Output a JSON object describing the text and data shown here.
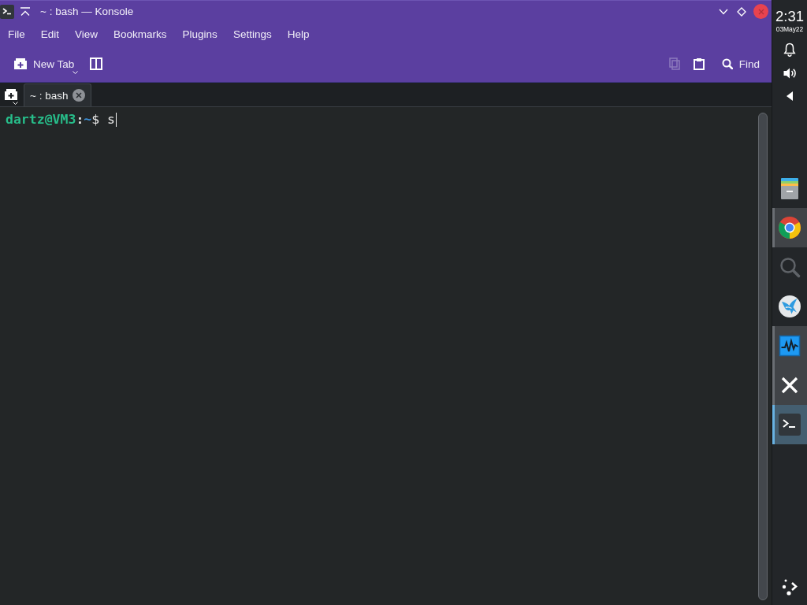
{
  "window": {
    "title": "~ : bash — Konsole"
  },
  "menu_bar": [
    "File",
    "Edit",
    "View",
    "Bookmarks",
    "Plugins",
    "Settings",
    "Help"
  ],
  "toolbar": {
    "left": [
      {
        "kind": "new-tab",
        "label": "New Tab",
        "disabled": false
      },
      {
        "kind": "split-view",
        "disabled": false
      }
    ],
    "right": [
      {
        "kind": "copy",
        "disabled": true
      },
      {
        "kind": "paste",
        "disabled": false
      },
      {
        "kind": "find",
        "label": "Find",
        "disabled": false
      }
    ]
  },
  "tabs": [
    {
      "label": "~ : bash",
      "selected": true
    }
  ],
  "terminal": {
    "lines": [
      {
        "user_host": "dartz@VM3",
        "separator": ":",
        "path": "~",
        "symbol": "$",
        "input": "s"
      }
    ]
  },
  "panel": {
    "clock": {
      "time": "2:31",
      "date": "03May22"
    },
    "tasks": [
      {
        "kind": "file-cabinet",
        "running": false,
        "selected": false
      },
      {
        "kind": "browser",
        "running": true,
        "selected": false
      },
      {
        "kind": "search",
        "running": false,
        "selected": false
      },
      {
        "kind": "bird",
        "running": false,
        "selected": false
      },
      {
        "kind": "monitor",
        "running": true,
        "selected": false
      },
      {
        "kind": "cross",
        "running": true,
        "selected": false
      },
      {
        "kind": "terminal",
        "running": true,
        "selected": true
      }
    ]
  }
}
